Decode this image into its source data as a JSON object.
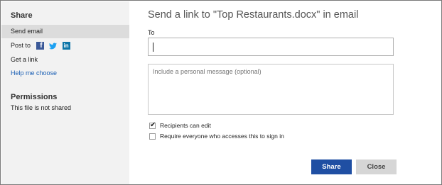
{
  "sidebar": {
    "share_heading": "Share",
    "items": [
      {
        "label": "Send email"
      },
      {
        "label": "Post to"
      },
      {
        "label": "Get a link"
      },
      {
        "label": "Help me choose"
      }
    ],
    "social": {
      "facebook": "f",
      "linkedin": "in"
    },
    "permissions_heading": "Permissions",
    "permissions_text": "This file is not shared"
  },
  "main": {
    "title": "Send a link to \"Top Restaurants.docx\" in email",
    "to_label": "To",
    "to_value": "",
    "message_placeholder": "Include a personal message (optional)",
    "checkboxes": [
      {
        "label": "Recipients can edit",
        "checked": true
      },
      {
        "label": "Require everyone who accesses this to sign in",
        "checked": false
      }
    ],
    "share_button": "Share",
    "close_button": "Close"
  },
  "colors": {
    "share_button_bg": "#1f4fa3",
    "link_color": "#1a5fb4",
    "facebook_blue": "#3b5998",
    "twitter_blue": "#1da1f2",
    "linkedin_blue": "#0e76a8"
  }
}
